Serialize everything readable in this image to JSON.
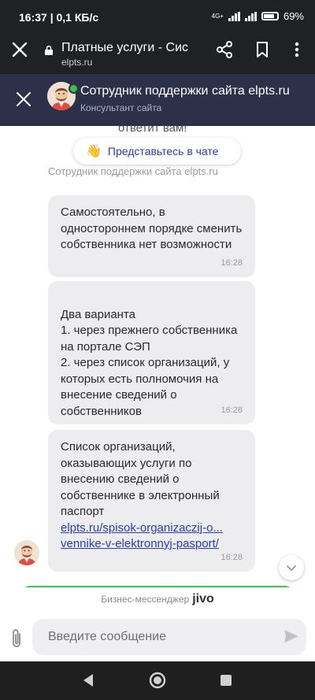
{
  "status_bar": {
    "time_speed": "16:37 | 0,1 КБ/с",
    "network": "4G+",
    "battery": "69%"
  },
  "browser": {
    "page_title": "Платные услуги - Сис",
    "domain": "elpts.ru"
  },
  "chat_header": {
    "agent_name": "Сотрудник поддержки сайта elpts.ru",
    "agent_role": "Консультант сайта"
  },
  "chat": {
    "cut_text": "ответит вам!",
    "intro_button": "Представьтесь в чате",
    "sender_label": "Сотрудник поддержки сайта elpts.ru",
    "messages": [
      {
        "text": "Самостоятельно, в одностороннем порядке сменить собственника нет возможности",
        "time": "16:28"
      },
      {
        "text": "Два варианта\n1. через прежнего собственника на портале СЭП\n2. через список организаций, у которых есть полномочия на внесение сведений о собственников",
        "time": "16:28"
      },
      {
        "text": "Список организаций, оказывающих услуги по внесению сведений о собственнике в электронный паспорт",
        "link_line1": "elpts.ru/spisok-organizaczij-o...",
        "link_line2": "vennike-v-elektronnyj-pasport/",
        "time": "16:28"
      }
    ]
  },
  "footer": {
    "powered_by": "Бизнес-мессенджер",
    "brand": "jivo",
    "input_placeholder": "Введите сообщение"
  },
  "colors": {
    "header_bg": "#2c3049",
    "bubble_bg": "#ededf0",
    "link": "#2a3cb8",
    "online": "#3cc14b"
  }
}
